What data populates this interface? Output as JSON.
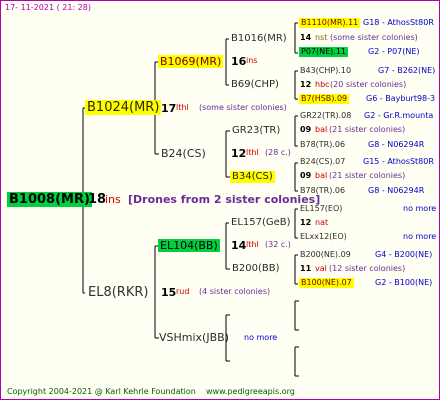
{
  "date_stamp": "17- 11-2021 ( 21: 28)",
  "root": {
    "name": "B1008(MR)",
    "num": "18",
    "unit": "ins",
    "note": "[Drones from 2 sister colonies]"
  },
  "gen1": [
    {
      "name": "B1024(MR)",
      "num": "17",
      "unit": "lthl",
      "note": "(some sister colonies)"
    },
    {
      "name": "EL8(RKR)",
      "num": "15",
      "unit": "rud",
      "note": "(4 sister colonies)"
    }
  ],
  "gen2": [
    {
      "name": "B1069(MR)",
      "num": "16",
      "unit": "ins"
    },
    {
      "name": "B24(CS)",
      "num": "12",
      "unit": "lthl",
      "note": "(28 c.)"
    },
    {
      "name": "EL104(BB)",
      "num": "14",
      "unit": "lthl",
      "note": "(32 c.)"
    },
    {
      "name": "VSHmix(JBB)",
      "note": "no more"
    }
  ],
  "gen3": [
    {
      "name": "B1016(MR)"
    },
    {
      "name": "B69(CHP)"
    },
    {
      "name": "GR23(TR)"
    },
    {
      "name": "B34(CS)"
    },
    {
      "name": "EL157(GeB)"
    },
    {
      "name": "B200(BB)"
    }
  ],
  "gen4": [
    {
      "name": "B1110(MR).11",
      "extra": "G18 - AthosSt80R"
    },
    {
      "num": "14",
      "unit": "nst",
      "note": "(some sister colonies)"
    },
    {
      "name": "P07(NE).11",
      "extra": "G2 - P07(NE)"
    },
    {
      "name": "B43(CHP).10",
      "extra": "G7 - B262(NE)"
    },
    {
      "num": "12",
      "unit": "hbc",
      "note": "(20 sister colonies)"
    },
    {
      "name": "B7(HSB).09",
      "extra": "G6 - Bayburt98-3"
    },
    {
      "name": "GR22(TR).08",
      "extra": "G2 - Gr.R.mounta"
    },
    {
      "num": "09",
      "unit": "bal",
      "note": "(21 sister colonies)"
    },
    {
      "name": "B78(TR).06",
      "extra": "G8 - N06294R"
    },
    {
      "name": "B24(CS).07",
      "extra": "G15 - AthosSt80R"
    },
    {
      "num": "09",
      "unit": "bal",
      "note": "(21 sister colonies)"
    },
    {
      "name": "B78(TR).06",
      "extra": "G8 - N06294R"
    },
    {
      "name": "EL157(EO)",
      "extra": "no more"
    },
    {
      "num": "12",
      "unit": "nat"
    },
    {
      "name": "ELxx12(EO)",
      "extra": "no more"
    },
    {
      "name": "B200(NE).09",
      "extra": "G4 - B200(NE)"
    },
    {
      "num": "11",
      "unit": "val",
      "note": "(12 sister colonies)"
    },
    {
      "name": "B100(NE).07",
      "extra": "G2 - B100(NE)"
    }
  ],
  "footer": {
    "copyright": "Copyright 2004-2021 @ Karl Kehrle Foundation",
    "url": "www.pedigreeapis.org"
  },
  "colors": {
    "frame": "#b000b0",
    "highlight_yellow": "#ffff00",
    "highlight_green": "#00d040",
    "line": "#000000"
  }
}
